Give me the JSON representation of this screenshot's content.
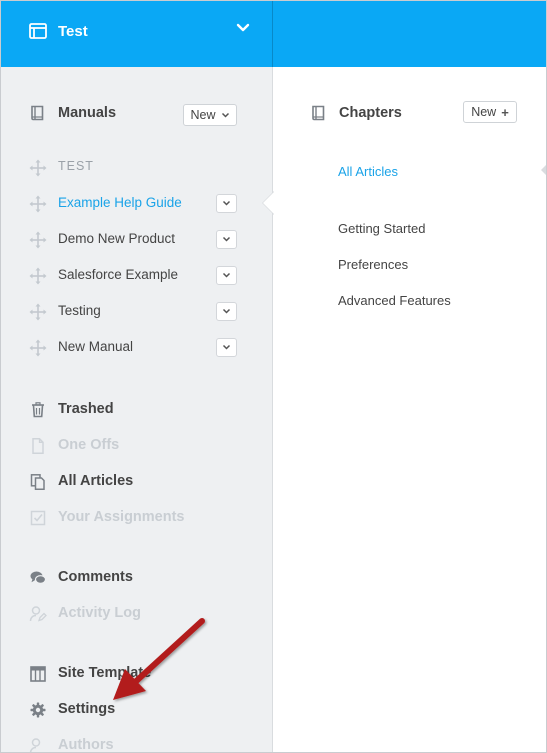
{
  "workspace": {
    "title": "Test"
  },
  "sidebar": {
    "manuals": {
      "heading": "Manuals",
      "new_label": "New",
      "items": [
        {
          "label": "TEST",
          "style": "group"
        },
        {
          "label": "Example Help Guide",
          "style": "active"
        },
        {
          "label": "Demo New Product",
          "style": "normal"
        },
        {
          "label": "Salesforce Example",
          "style": "normal"
        },
        {
          "label": "Testing",
          "style": "normal"
        },
        {
          "label": "New Manual",
          "style": "normal"
        }
      ]
    },
    "nav": {
      "trashed": "Trashed",
      "one_offs": "One Offs",
      "all_articles": "All Articles",
      "your_assignments": "Your Assignments",
      "comments": "Comments",
      "activity_log": "Activity Log",
      "site_template": "Site Template",
      "settings": "Settings",
      "authors": "Authors"
    }
  },
  "main": {
    "chapters": {
      "heading": "Chapters",
      "new_label": "New",
      "all_articles": "All Articles",
      "items": [
        "Getting Started",
        "Preferences",
        "Advanced Features"
      ]
    }
  },
  "colors": {
    "topbar": "#0aa8f5",
    "accent": "#1aa3e8",
    "sidebar_bg": "#eef0f2",
    "annotation_arrow": "#b21e1e"
  }
}
